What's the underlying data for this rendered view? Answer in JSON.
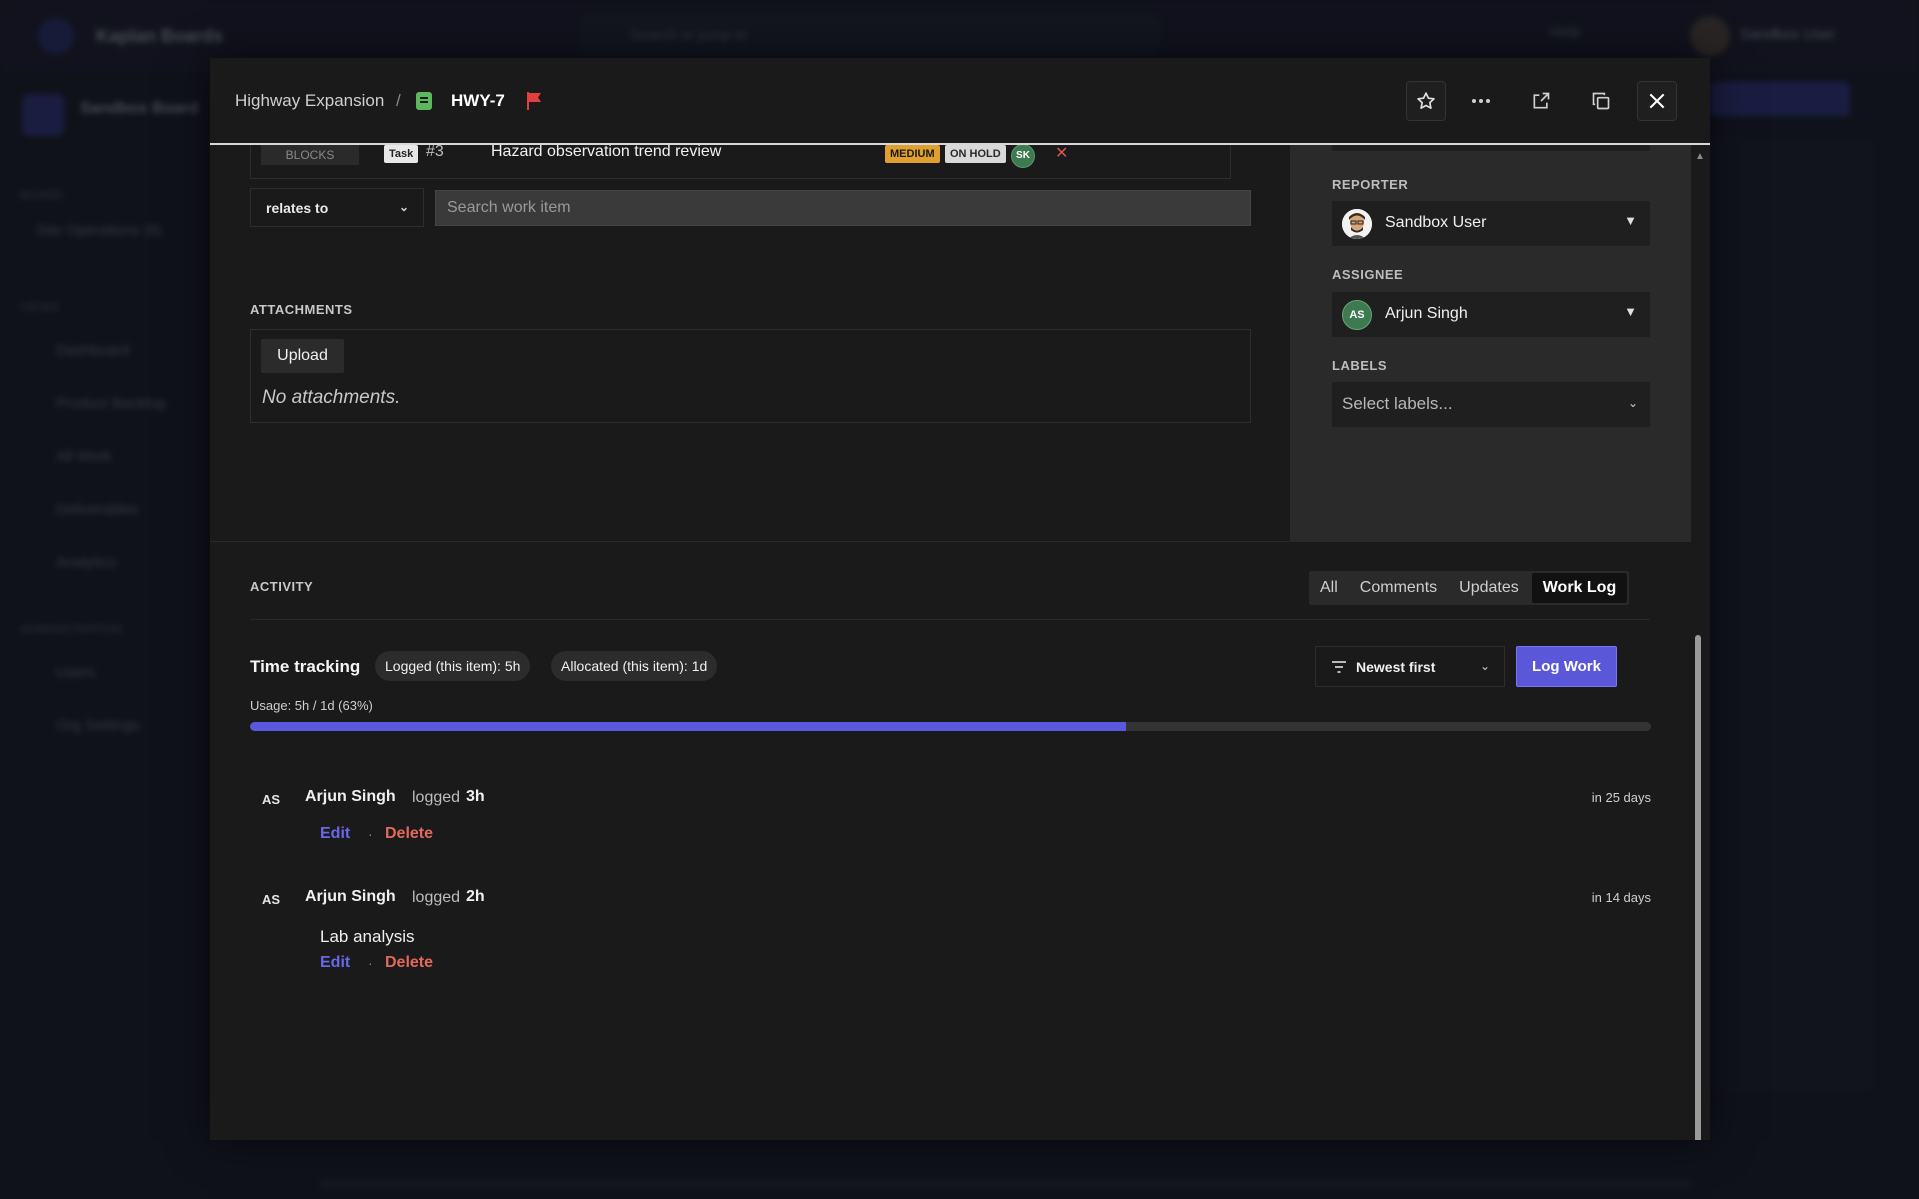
{
  "background": {
    "app_name": "Kaplan Boards",
    "search_placeholder": "Search or jump to",
    "help": "Help",
    "user": "Sandbox User",
    "project": "Sandbox Board",
    "section_boards": "BOARD",
    "board_item": "Site Operations (9)",
    "section_views": "VIEWS",
    "nav": [
      "Dashboard",
      "Product Backlog",
      "All Work",
      "Deliverables",
      "Analytics"
    ],
    "section_admin": "ADMINISTRATION",
    "admin_nav": [
      "Users",
      "Org Settings"
    ]
  },
  "header": {
    "breadcrumb_project": "Highway Expansion",
    "breadcrumb_sep": "/",
    "item_key": "HWY-7",
    "flag_color": "#e0413e",
    "icons": [
      "star-icon",
      "more-icon",
      "external-link-icon",
      "copy-icon",
      "close-icon"
    ]
  },
  "links": {
    "link_type": "BLOCKS",
    "item_type": "Task",
    "item_number": "#3",
    "item_title": "Hazard observation trend review",
    "priority": "MEDIUM",
    "status": "ON HOLD",
    "assignee_initials": "SK",
    "remove": "✕",
    "relation_select": "relates to",
    "search_placeholder": "Search work item"
  },
  "attachments": {
    "label": "ATTACHMENTS",
    "upload": "Upload",
    "empty": "No attachments."
  },
  "sidebar": {
    "reporter_label": "REPORTER",
    "reporter": "Sandbox User",
    "assignee_label": "ASSIGNEE",
    "assignee": "Arjun Singh",
    "assignee_initials": "AS",
    "labels_label": "LABELS",
    "labels_placeholder": "Select labels..."
  },
  "activity": {
    "label": "ACTIVITY",
    "tabs": [
      "All",
      "Comments",
      "Updates",
      "Work Log"
    ],
    "active_tab": "Work Log",
    "time_tracking_title": "Time tracking",
    "logged_pill": "Logged (this item): 5h",
    "allocated_pill": "Allocated (this item): 1d",
    "sort": "Newest first",
    "log_work": "Log Work",
    "usage": "Usage: 5h / 1d (63%)",
    "usage_percent": 62.5,
    "entries": [
      {
        "initials": "AS",
        "name": "Arjun Singh",
        "verb": "logged",
        "amount": "3h",
        "time": "in 25 days",
        "note": "",
        "edit": "Edit",
        "sep": "·",
        "delete": "Delete"
      },
      {
        "initials": "AS",
        "name": "Arjun Singh",
        "verb": "logged",
        "amount": "2h",
        "time": "in 14 days",
        "note": "Lab analysis",
        "edit": "Edit",
        "sep": "·",
        "delete": "Delete"
      }
    ]
  },
  "colors": {
    "accent": "#5b58e0",
    "delete": "#e26a5a",
    "priority_medium": "#e0a030"
  }
}
